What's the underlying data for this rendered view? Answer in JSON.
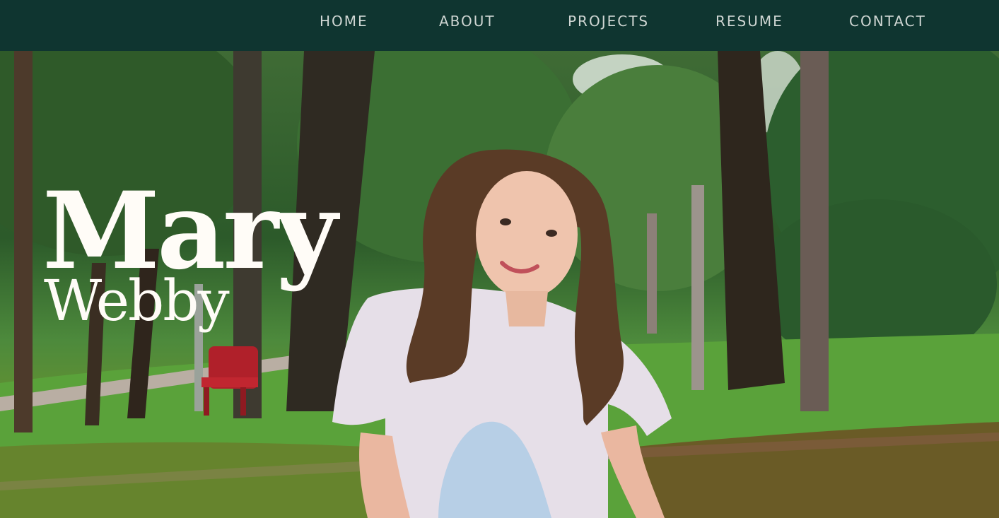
{
  "nav": {
    "items": [
      {
        "label": "HOME"
      },
      {
        "label": "ABOUT"
      },
      {
        "label": "PROJECTS"
      },
      {
        "label": "RESUME"
      },
      {
        "label": "CONTACT"
      }
    ]
  },
  "hero": {
    "first_name": "Mary",
    "last_name": "Webby",
    "photo_subject": "portrait-photo"
  },
  "colors": {
    "nav_background": "#0f3530",
    "nav_text": "#cfd6d3",
    "name_text": "#fffcf7"
  }
}
